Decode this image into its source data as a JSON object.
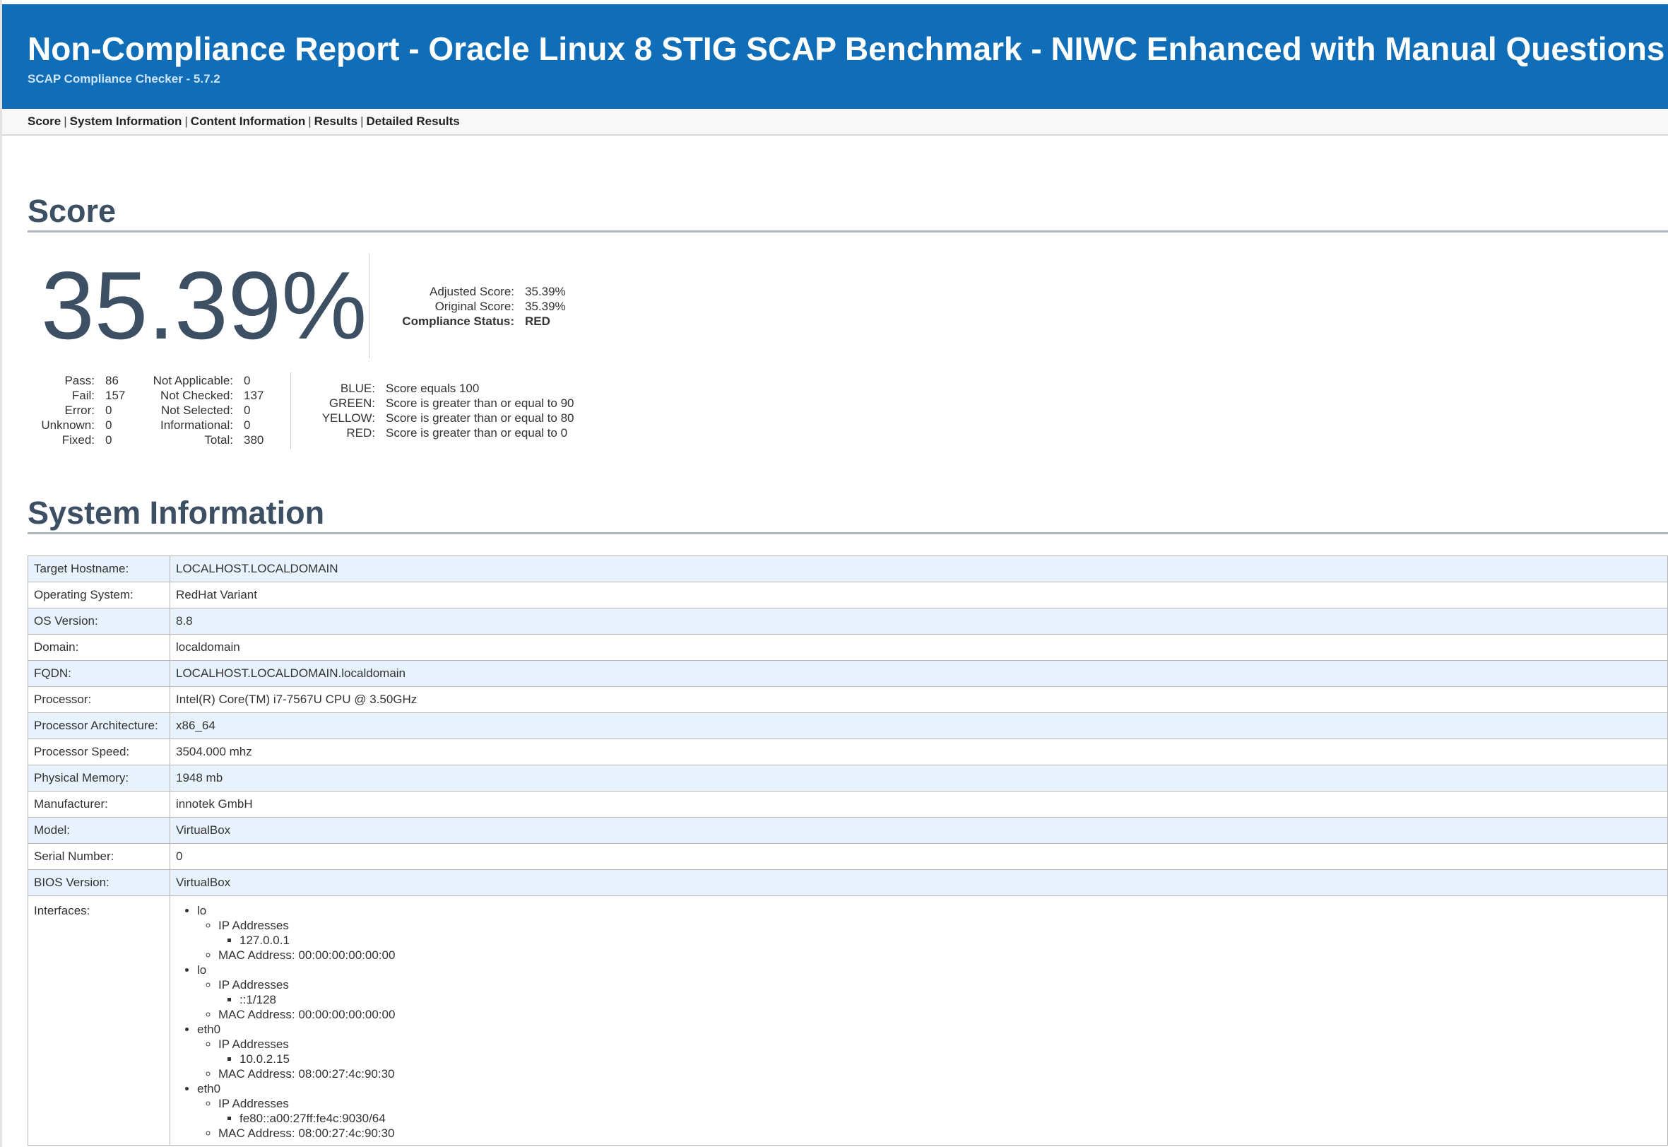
{
  "header": {
    "title": "Non-Compliance Report - Oracle Linux 8 STIG SCAP Benchmark - NIWC Enhanced with Manual Questions",
    "subtitle": "SCAP Compliance Checker - 5.7.2",
    "background_color": "#106eb9"
  },
  "nav": {
    "items": [
      "Score",
      "System Information",
      "Content Information",
      "Results",
      "Detailed Results"
    ],
    "separator": "|"
  },
  "score": {
    "heading": "Score",
    "big_value": "35.39%",
    "adjusted_label": "Adjusted Score:",
    "adjusted_value": "35.39%",
    "original_label": "Original Score:",
    "original_value": "35.39%",
    "status_label": "Compliance Status:",
    "status_value": "RED",
    "counts_left": [
      {
        "label": "Pass:",
        "value": "86"
      },
      {
        "label": "Fail:",
        "value": "157"
      },
      {
        "label": "Error:",
        "value": "0"
      },
      {
        "label": "Unknown:",
        "value": "0"
      },
      {
        "label": "Fixed:",
        "value": "0"
      }
    ],
    "counts_right": [
      {
        "label": "Not Applicable:",
        "value": "0"
      },
      {
        "label": "Not Checked:",
        "value": "137"
      },
      {
        "label": "Not Selected:",
        "value": "0"
      },
      {
        "label": "Informational:",
        "value": "0"
      },
      {
        "label": "Total:",
        "value": "380"
      }
    ],
    "legend": [
      {
        "label": "BLUE:",
        "text": "Score equals 100"
      },
      {
        "label": "GREEN:",
        "text": "Score is greater than or equal to 90"
      },
      {
        "label": "YELLOW:",
        "text": "Score is greater than or equal to 80"
      },
      {
        "label": "RED:",
        "text": "Score is greater than or equal to 0"
      }
    ]
  },
  "system_info": {
    "heading": "System Information",
    "rows": [
      {
        "label": "Target Hostname:",
        "value": "LOCALHOST.LOCALDOMAIN"
      },
      {
        "label": "Operating System:",
        "value": "RedHat Variant"
      },
      {
        "label": "OS Version:",
        "value": "8.8"
      },
      {
        "label": "Domain:",
        "value": "localdomain"
      },
      {
        "label": "FQDN:",
        "value": "LOCALHOST.LOCALDOMAIN.localdomain"
      },
      {
        "label": "Processor:",
        "value": "Intel(R) Core(TM) i7-7567U CPU @ 3.50GHz"
      },
      {
        "label": "Processor Architecture:",
        "value": "x86_64"
      },
      {
        "label": "Processor Speed:",
        "value": "3504.000 mhz"
      },
      {
        "label": "Physical Memory:",
        "value": "1948 mb"
      },
      {
        "label": "Manufacturer:",
        "value": "innotek GmbH"
      },
      {
        "label": "Model:",
        "value": "VirtualBox"
      },
      {
        "label": "Serial Number:",
        "value": "0"
      },
      {
        "label": "BIOS Version:",
        "value": "VirtualBox"
      }
    ],
    "interfaces_label": "Interfaces:",
    "interfaces": [
      {
        "name": "lo",
        "ip_label": "IP Addresses",
        "ip": "127.0.0.1",
        "mac": "MAC Address: 00:00:00:00:00:00"
      },
      {
        "name": "lo",
        "ip_label": "IP Addresses",
        "ip": "::1/128",
        "mac": "MAC Address: 00:00:00:00:00:00"
      },
      {
        "name": "eth0",
        "ip_label": "IP Addresses",
        "ip": "10.0.2.15",
        "mac": "MAC Address: 08:00:27:4c:90:30"
      },
      {
        "name": "eth0",
        "ip_label": "IP Addresses",
        "ip": "fe80::a00:27ff:fe4c:9030/64",
        "mac": "MAC Address: 08:00:27:4c:90:30"
      }
    ]
  }
}
